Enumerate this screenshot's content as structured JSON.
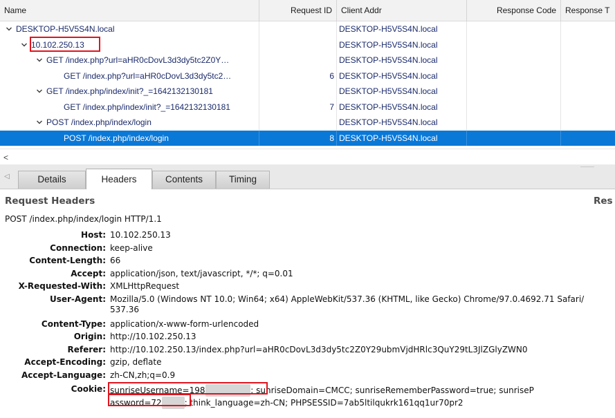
{
  "grid": {
    "columns": [
      "Name",
      "Request ID",
      "Client Addr",
      "Response Code",
      "Response T"
    ],
    "rows": [
      {
        "indent": 0,
        "expanded": true,
        "name": "DESKTOP-H5V5S4N.local",
        "request_id": "",
        "client_addr": "DESKTOP-H5V5S4N.local",
        "selected": false
      },
      {
        "indent": 1,
        "expanded": true,
        "name": "10.102.250.13",
        "request_id": "",
        "client_addr": "DESKTOP-H5V5S4N.local",
        "selected": false,
        "highlighted": true
      },
      {
        "indent": 2,
        "expanded": true,
        "name": "GET /index.php?url=aHR0cDovL3d3dy5tc2Z0Y…",
        "request_id": "",
        "client_addr": "DESKTOP-H5V5S4N.local",
        "selected": false
      },
      {
        "indent": 3,
        "expanded": null,
        "name": "GET /index.php?url=aHR0cDovL3d3dy5tc2…",
        "request_id": "6",
        "client_addr": "DESKTOP-H5V5S4N.local",
        "selected": false
      },
      {
        "indent": 2,
        "expanded": true,
        "name": "GET /index.php/index/init?_=1642132130181",
        "request_id": "",
        "client_addr": "DESKTOP-H5V5S4N.local",
        "selected": false
      },
      {
        "indent": 3,
        "expanded": null,
        "name": "GET /index.php/index/init?_=1642132130181",
        "request_id": "7",
        "client_addr": "DESKTOP-H5V5S4N.local",
        "selected": false
      },
      {
        "indent": 2,
        "expanded": true,
        "name": "POST /index.php/index/login",
        "request_id": "",
        "client_addr": "DESKTOP-H5V5S4N.local",
        "selected": false
      },
      {
        "indent": 3,
        "expanded": null,
        "name": "POST /index.php/index/login",
        "request_id": "8",
        "client_addr": "DESKTOP-H5V5S4N.local",
        "selected": true
      }
    ]
  },
  "scrollbar": {
    "left_arrow": "<"
  },
  "tabs": [
    {
      "label": "Details",
      "active": false
    },
    {
      "label": "Headers",
      "active": true
    },
    {
      "label": "Contents",
      "active": false
    },
    {
      "label": "Timing",
      "active": false
    }
  ],
  "headers_panel": {
    "title": "Request Headers",
    "right_title": "Res",
    "request_line": "POST /index.php/index/login HTTP/1.1",
    "headers": [
      {
        "key": "Host:",
        "value": "10.102.250.13"
      },
      {
        "key": "Connection:",
        "value": "keep-alive"
      },
      {
        "key": "Content-Length:",
        "value": "66"
      },
      {
        "key": "Accept:",
        "value": "application/json, text/javascript, */*; q=0.01"
      },
      {
        "key": "X-Requested-With:",
        "value": "XMLHttpRequest"
      },
      {
        "key": "User-Agent:",
        "value": "Mozilla/5.0 (Windows NT 10.0; Win64; x64) AppleWebKit/537.36 (KHTML, like Gecko) Chrome/97.0.4692.71 Safari/537.36"
      },
      {
        "key": "Content-Type:",
        "value": "application/x-www-form-urlencoded"
      },
      {
        "key": "Origin:",
        "value": "http://10.102.250.13"
      },
      {
        "key": "Referer:",
        "value": "http://10.102.250.13/index.php?url=aHR0cDovL3d3dy5tc2Z0Y29ubmVjdHRlc3QuY29tL3JlZGlyZWN0"
      },
      {
        "key": "Accept-Encoding:",
        "value": "gzip, deflate"
      },
      {
        "key": "Accept-Language:",
        "value": "zh-CN,zh;q=0.9"
      }
    ],
    "cookie": {
      "key": "Cookie:",
      "user_prefix": "sunriseUsername=198",
      "user_tail": "; sunriseDomain=CMCC; sunriseRememberPassword=true; sunriseP",
      "pass_prefix": "assword=72",
      "pass_tail": "; think_language=zh-CN; PHPSESSID=7ab5ltilqukrk161qq1ur70pr2"
    }
  },
  "colors": {
    "selection": "#0a78d7",
    "highlight_box": "#e0141e",
    "row_text": "#1a2a6a"
  }
}
